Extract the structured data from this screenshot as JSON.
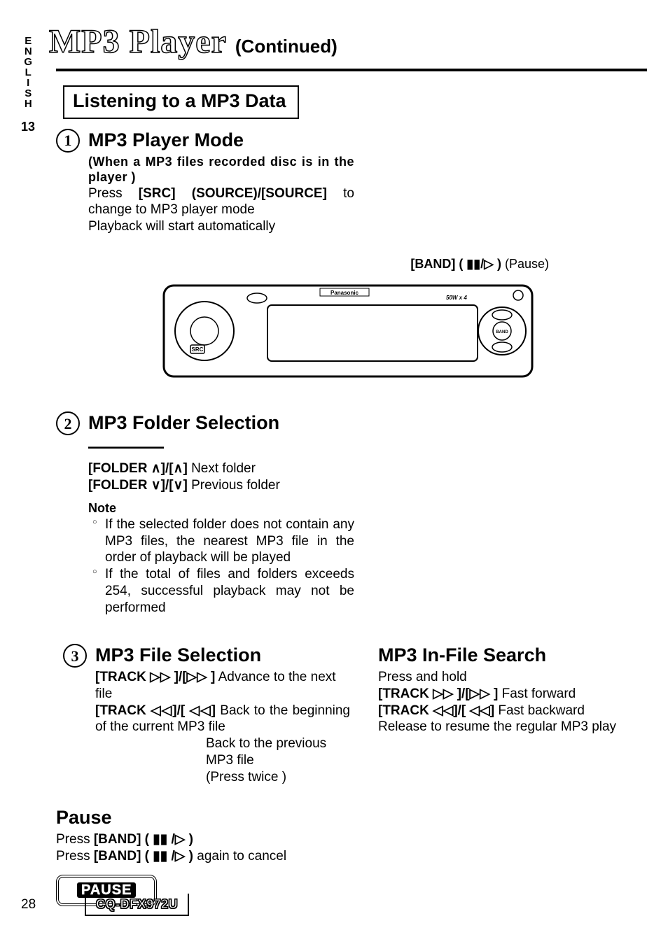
{
  "side": {
    "lang": "ENGLISH",
    "num": "13"
  },
  "title": {
    "main": "MP3 Player",
    "sub": "(Continued)"
  },
  "boxHeading": "Listening to a MP3 Data",
  "step1": {
    "num": "1",
    "heading": "MP3 Player Mode",
    "paren": "(When a MP3 files recorded disc is in the player )",
    "line1a": "Press ",
    "line1b": "[SRC] (SOURCE)/[SOURCE]",
    "line1c": " to change to MP3 player mode",
    "line2": "Playback will start automatically"
  },
  "callout": {
    "b": "[BAND] ( ▮▮/▷ )",
    "t": " (Pause)"
  },
  "device": {
    "brand": "Panasonic",
    "power": "50W x 4"
  },
  "step2": {
    "num": "2",
    "heading": "MP3 Folder Selection",
    "l1a": "[FOLDER ∧]/[∧]",
    "l1b": "  Next folder",
    "l2a": "[FOLDER ∨]/[∨]",
    "l2b": "  Previous folder",
    "noteLabel": "Note",
    "n1": "If the selected folder does not contain any MP3 files, the nearest MP3 file in the order of playback will be played",
    "n2": "If the total of files and folders exceeds 254, successful playback may not be performed"
  },
  "step3": {
    "num": "3",
    "heading": "MP3 File Selection",
    "l1a": "[TRACK ▷▷ ]/[▷▷ ]",
    "l1b": "  Advance to the next file",
    "l2a": "[TRACK ◁◁]/[ ◁◁]",
    "l2b": "  Back to the beginning of the current MP3 file",
    "l3": "Back to the previous MP3 file",
    "l4": "(Press twice )"
  },
  "infile": {
    "heading": "MP3 In-File Search",
    "p1": "Press and hold",
    "l1a": "[TRACK ▷▷ ]/[▷▷ ]",
    "l1b": "  Fast forward",
    "l2a": "[TRACK ◁◁]/[ ◁◁]",
    "l2b": "  Fast backward",
    "p2": "Release to resume the regular MP3 play"
  },
  "pause": {
    "heading": "Pause",
    "l1a": "Press ",
    "l1b": "[BAND] ( ▮▮ /▷ )",
    "l2a": "Press ",
    "l2b": "[BAND] ( ▮▮ /▷ )",
    "l2c": " again to cancel",
    "chip": "PAUSE"
  },
  "footer": {
    "page": "28",
    "model": "CQ-DFX972U"
  }
}
